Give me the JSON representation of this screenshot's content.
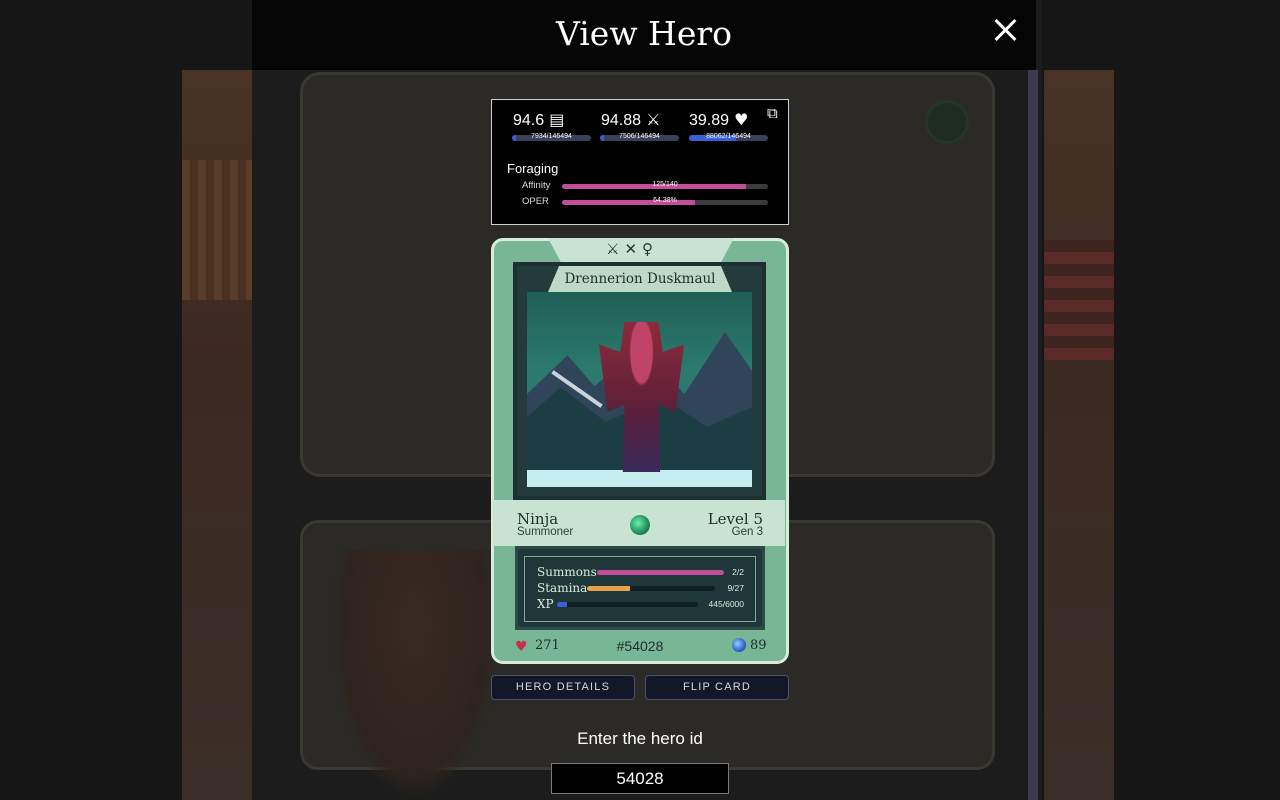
{
  "modal": {
    "title": "View Hero",
    "close_icon": "close-icon"
  },
  "stats": {
    "items": [
      {
        "value": "94.6",
        "icon": "book-icon",
        "progress": "7934/146494",
        "fraction": 0.054
      },
      {
        "value": "94.88",
        "icon": "crossed-swords-icon",
        "progress": "7506/146494",
        "fraction": 0.051
      },
      {
        "value": "39.89",
        "icon": "heart-icon",
        "progress": "88062/146494",
        "fraction": 0.601
      }
    ],
    "external_icon": "external-link-icon",
    "profession": "Foraging",
    "rows": [
      {
        "label": "Affinity",
        "value": "125/140",
        "fraction": 0.893
      },
      {
        "label": "OPER",
        "value": "64.38%",
        "fraction": 0.6438
      }
    ]
  },
  "card": {
    "top_icons": "⚔✕♀",
    "name": "Drennerion Duskmaul",
    "main_class": "Ninja",
    "sub_class": "Summoner",
    "level": "Level 5",
    "generation": "Gen 3",
    "summons_label": "Summons",
    "summons_value": "2/2",
    "summons_fraction": 1.0,
    "stamina_label": "Stamina",
    "stamina_value": "9/27",
    "stamina_fraction": 0.333,
    "xp_label": "XP",
    "xp_value": "445/6000",
    "xp_fraction": 0.074,
    "hp": "271",
    "hero_number": "#54028",
    "mp": "89",
    "colors": {
      "card": "#78b695",
      "summons": "#c14e9b",
      "stamina": "#e9a04a",
      "xp": "#3b5fd6"
    }
  },
  "buttons": {
    "hero_details": "HERO DETAILS",
    "flip_card": "FLIP CARD"
  },
  "lookup": {
    "label": "Enter the hero id",
    "value": "54028"
  }
}
